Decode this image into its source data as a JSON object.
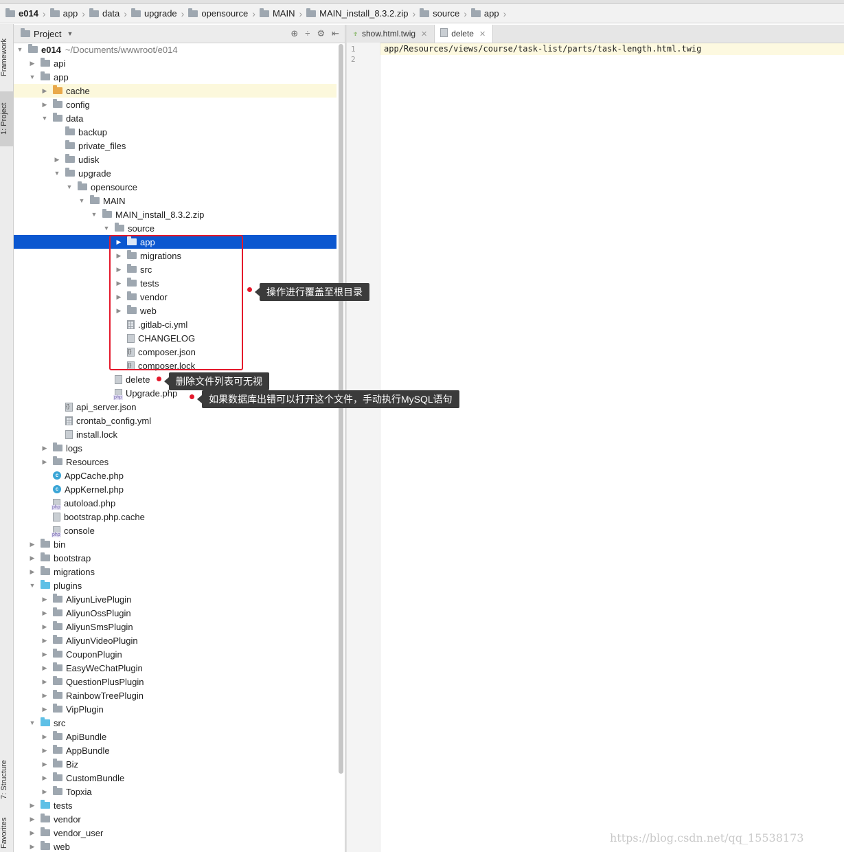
{
  "breadcrumb": [
    "e014",
    "app",
    "data",
    "upgrade",
    "opensource",
    "MAIN",
    "MAIN_install_8.3.2.zip",
    "source",
    "app"
  ],
  "side_tabs": {
    "framework": "Framework",
    "project": "1: Project",
    "structure": "7: Structure",
    "favorites": "Favorites"
  },
  "panel": {
    "title": "Project"
  },
  "tabs": [
    {
      "label": "show.html.twig"
    },
    {
      "label": "delete"
    }
  ],
  "editor": {
    "line_numbers": [
      "1",
      "2"
    ],
    "code": "app/Resources/views/course/task-list/parts/task-length.html.twig"
  },
  "tree": [
    {
      "label": "e014",
      "sub": "~/Documents/wwwroot/e014",
      "depth": 0,
      "arrow": "open",
      "icon": "folder",
      "bold": true
    },
    {
      "label": "api",
      "depth": 1,
      "arrow": "closed",
      "icon": "folder"
    },
    {
      "label": "app",
      "depth": 1,
      "arrow": "open",
      "icon": "folder"
    },
    {
      "label": "cache",
      "depth": 2,
      "arrow": "closed",
      "icon": "folder-orange",
      "state": "hl"
    },
    {
      "label": "config",
      "depth": 2,
      "arrow": "closed",
      "icon": "folder"
    },
    {
      "label": "data",
      "depth": 2,
      "arrow": "open",
      "icon": "folder"
    },
    {
      "label": "backup",
      "depth": 3,
      "arrow": "none",
      "icon": "folder"
    },
    {
      "label": "private_files",
      "depth": 3,
      "arrow": "none",
      "icon": "folder"
    },
    {
      "label": "udisk",
      "depth": 3,
      "arrow": "closed",
      "icon": "folder"
    },
    {
      "label": "upgrade",
      "depth": 3,
      "arrow": "open",
      "icon": "folder"
    },
    {
      "label": "opensource",
      "depth": 4,
      "arrow": "open",
      "icon": "folder"
    },
    {
      "label": "MAIN",
      "depth": 5,
      "arrow": "open",
      "icon": "folder"
    },
    {
      "label": "MAIN_install_8.3.2.zip",
      "depth": 6,
      "arrow": "open",
      "icon": "folder"
    },
    {
      "label": "source",
      "depth": 7,
      "arrow": "open",
      "icon": "folder"
    },
    {
      "label": "app",
      "depth": 8,
      "arrow": "closed",
      "icon": "folder-white",
      "state": "sel"
    },
    {
      "label": "migrations",
      "depth": 8,
      "arrow": "closed",
      "icon": "folder"
    },
    {
      "label": "src",
      "depth": 8,
      "arrow": "closed",
      "icon": "folder"
    },
    {
      "label": "tests",
      "depth": 8,
      "arrow": "closed",
      "icon": "folder"
    },
    {
      "label": "vendor",
      "depth": 8,
      "arrow": "closed",
      "icon": "folder"
    },
    {
      "label": "web",
      "depth": 8,
      "arrow": "closed",
      "icon": "folder"
    },
    {
      "label": ".gitlab-ci.yml",
      "depth": 8,
      "arrow": "none",
      "icon": "yml"
    },
    {
      "label": "CHANGELOG",
      "depth": 8,
      "arrow": "none",
      "icon": "file"
    },
    {
      "label": "composer.json",
      "depth": 8,
      "arrow": "none",
      "icon": "json"
    },
    {
      "label": "composer.lock",
      "depth": 8,
      "arrow": "none",
      "icon": "json"
    },
    {
      "label": "delete",
      "depth": 7,
      "arrow": "none",
      "icon": "file"
    },
    {
      "label": "Upgrade.php",
      "depth": 7,
      "arrow": "none",
      "icon": "php"
    },
    {
      "label": "api_server.json",
      "depth": 3,
      "arrow": "none",
      "icon": "json"
    },
    {
      "label": "crontab_config.yml",
      "depth": 3,
      "arrow": "none",
      "icon": "yml"
    },
    {
      "label": "install.lock",
      "depth": 3,
      "arrow": "none",
      "icon": "file"
    },
    {
      "label": "logs",
      "depth": 2,
      "arrow": "closed",
      "icon": "folder"
    },
    {
      "label": "Resources",
      "depth": 2,
      "arrow": "closed",
      "icon": "folder"
    },
    {
      "label": "AppCache.php",
      "depth": 2,
      "arrow": "none",
      "icon": "class"
    },
    {
      "label": "AppKernel.php",
      "depth": 2,
      "arrow": "none",
      "icon": "class"
    },
    {
      "label": "autoload.php",
      "depth": 2,
      "arrow": "none",
      "icon": "php"
    },
    {
      "label": "bootstrap.php.cache",
      "depth": 2,
      "arrow": "none",
      "icon": "file"
    },
    {
      "label": "console",
      "depth": 2,
      "arrow": "none",
      "icon": "php"
    },
    {
      "label": "bin",
      "depth": 1,
      "arrow": "closed",
      "icon": "folder"
    },
    {
      "label": "bootstrap",
      "depth": 1,
      "arrow": "closed",
      "icon": "folder"
    },
    {
      "label": "migrations",
      "depth": 1,
      "arrow": "closed",
      "icon": "folder"
    },
    {
      "label": "plugins",
      "depth": 1,
      "arrow": "open",
      "icon": "folder-blue"
    },
    {
      "label": "AliyunLivePlugin",
      "depth": 2,
      "arrow": "closed",
      "icon": "folder"
    },
    {
      "label": "AliyunOssPlugin",
      "depth": 2,
      "arrow": "closed",
      "icon": "folder"
    },
    {
      "label": "AliyunSmsPlugin",
      "depth": 2,
      "arrow": "closed",
      "icon": "folder"
    },
    {
      "label": "AliyunVideoPlugin",
      "depth": 2,
      "arrow": "closed",
      "icon": "folder"
    },
    {
      "label": "CouponPlugin",
      "depth": 2,
      "arrow": "closed",
      "icon": "folder"
    },
    {
      "label": "EasyWeChatPlugin",
      "depth": 2,
      "arrow": "closed",
      "icon": "folder"
    },
    {
      "label": "QuestionPlusPlugin",
      "depth": 2,
      "arrow": "closed",
      "icon": "folder"
    },
    {
      "label": "RainbowTreePlugin",
      "depth": 2,
      "arrow": "closed",
      "icon": "folder"
    },
    {
      "label": "VipPlugin",
      "depth": 2,
      "arrow": "closed",
      "icon": "folder"
    },
    {
      "label": "src",
      "depth": 1,
      "arrow": "open",
      "icon": "folder-blue"
    },
    {
      "label": "ApiBundle",
      "depth": 2,
      "arrow": "closed",
      "icon": "folder"
    },
    {
      "label": "AppBundle",
      "depth": 2,
      "arrow": "closed",
      "icon": "folder"
    },
    {
      "label": "Biz",
      "depth": 2,
      "arrow": "closed",
      "icon": "folder"
    },
    {
      "label": "CustomBundle",
      "depth": 2,
      "arrow": "closed",
      "icon": "folder"
    },
    {
      "label": "Topxia",
      "depth": 2,
      "arrow": "closed",
      "icon": "folder"
    },
    {
      "label": "tests",
      "depth": 1,
      "arrow": "closed",
      "icon": "folder-blue"
    },
    {
      "label": "vendor",
      "depth": 1,
      "arrow": "closed",
      "icon": "folder"
    },
    {
      "label": "vendor_user",
      "depth": 1,
      "arrow": "closed",
      "icon": "folder"
    },
    {
      "label": "web",
      "depth": 1,
      "arrow": "closed",
      "icon": "folder"
    }
  ],
  "annotations": {
    "overwrite": "操作进行覆盖至根目录",
    "delete_note": "删除文件列表可无视",
    "upgrade_note": "如果数据库出错可以打开这个文件，手动执行MySQL语句"
  },
  "watermark": "https://blog.csdn.net/qq_15538173"
}
